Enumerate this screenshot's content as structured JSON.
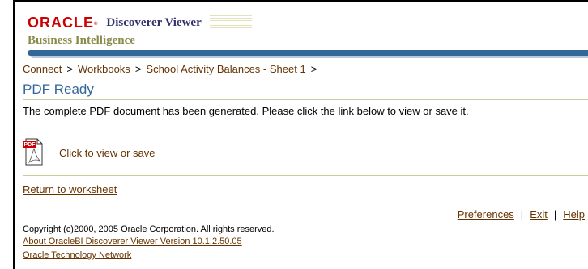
{
  "branding": {
    "logo_text": "ORACLE",
    "product_name": "Discoverer Viewer",
    "sub_brand": "Business Intelligence"
  },
  "breadcrumb": {
    "items": [
      "Connect",
      "Workbooks",
      "School Activity Balances - Sheet 1"
    ],
    "separator": ">"
  },
  "page": {
    "title": "PDF Ready",
    "instructions": "The complete PDF document has been generated. Please click the link below to view or save it.",
    "pdf_icon_label": "PDF",
    "pdf_link": "Click to view or save",
    "return_link": "Return to worksheet"
  },
  "global_links": {
    "preferences": "Preferences",
    "exit": "Exit",
    "help": "Help",
    "separator": "|"
  },
  "footer": {
    "copyright": "Copyright (c)2000, 2005 Oracle Corporation. All rights reserved.",
    "about": "About OracleBI Discoverer Viewer Version 10.1.2.50.05",
    "otn": "Oracle Technology Network"
  },
  "colors": {
    "brand_red": "#cc0000",
    "header_blue": "#336699",
    "link_brown": "#663300",
    "rule_tan": "#cccc99"
  }
}
